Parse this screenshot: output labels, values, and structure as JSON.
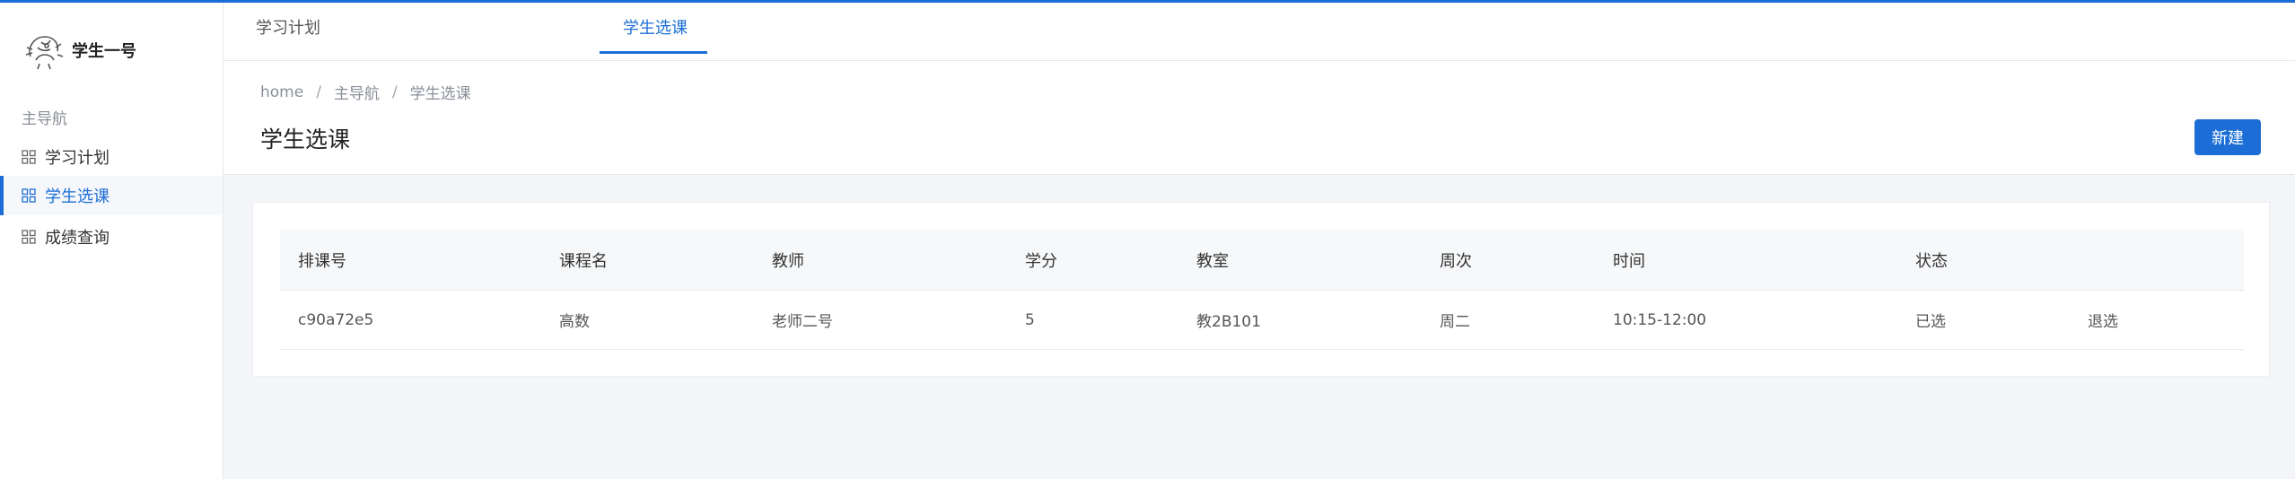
{
  "brand": {
    "name": "学生一号",
    "logo_icon": "dragon-logo-icon"
  },
  "sidebar": {
    "group_label": "主导航",
    "items": [
      {
        "label": "学习计划",
        "icon": "grid-icon"
      },
      {
        "label": "学生选课",
        "icon": "grid-icon",
        "active": true
      },
      {
        "label": "成绩查询",
        "icon": "grid-icon"
      }
    ]
  },
  "tabs": [
    {
      "label": "学习计划"
    },
    {
      "label": "学生选课",
      "active": true
    }
  ],
  "breadcrumb": [
    "home",
    "主导航",
    "学生选课"
  ],
  "page": {
    "title": "学生选课",
    "new_button": "新建"
  },
  "table": {
    "headers": [
      "排课号",
      "课程名",
      "教师",
      "学分",
      "教室",
      "周次",
      "时间",
      "状态",
      ""
    ],
    "rows": [
      [
        "c90a72e5",
        "高数",
        "老师二号",
        "5",
        "教2B101",
        "周二",
        "10:15-12:00",
        "已选",
        "退选"
      ]
    ]
  },
  "colors": {
    "accent": "#1c6ed6",
    "background": "#f4f5f8",
    "header_row": "#f7f8fa"
  }
}
